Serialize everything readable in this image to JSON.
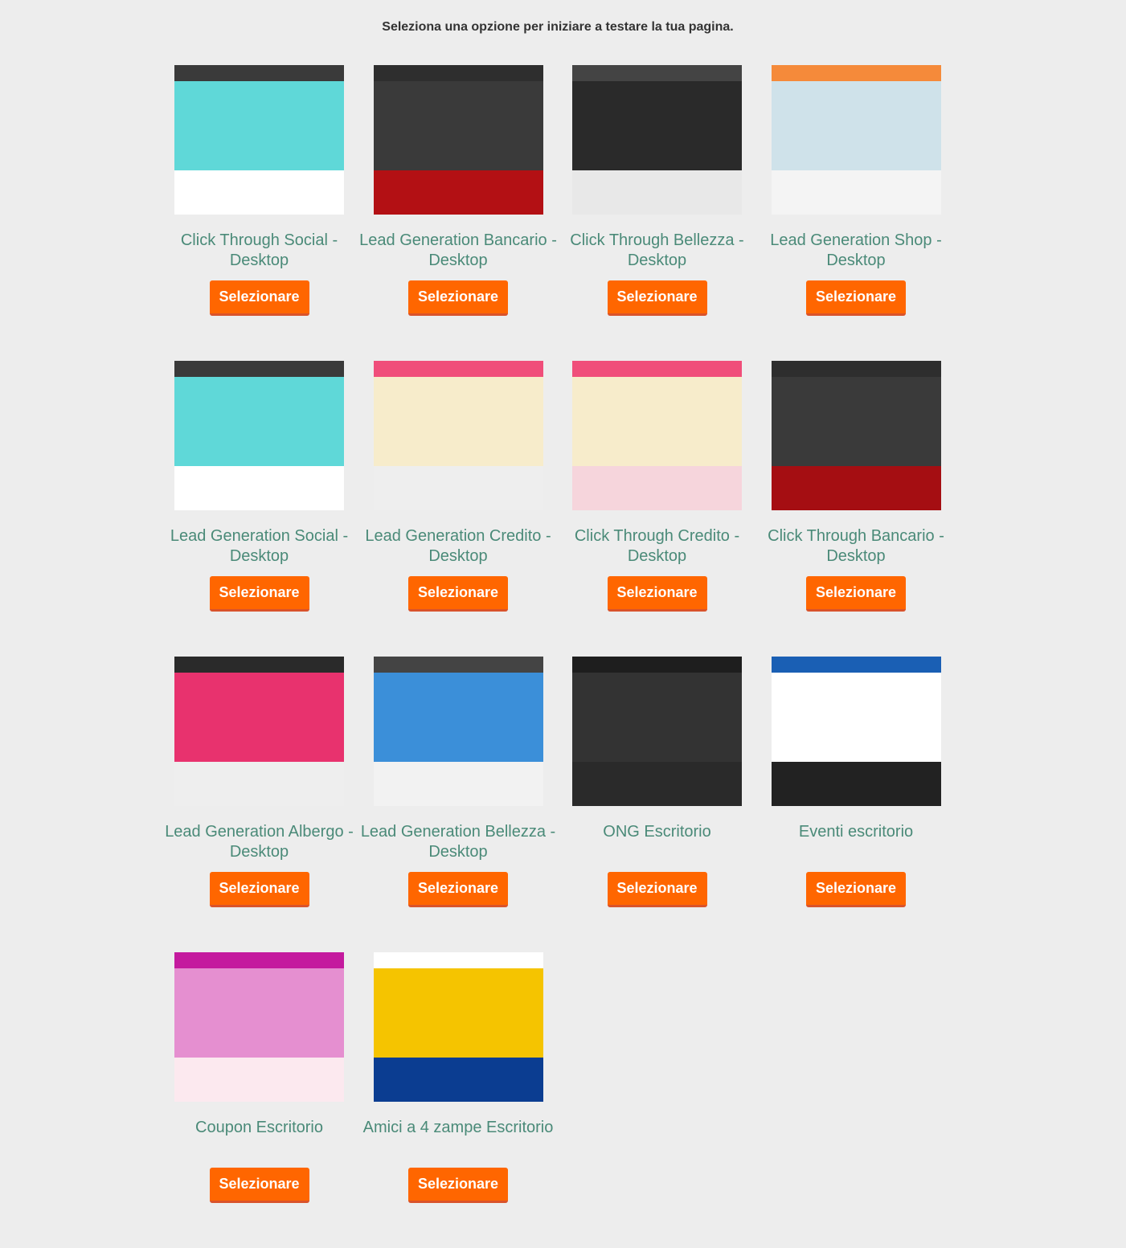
{
  "intro": "Seleziona una opzione per iniziare a testare la tua pagina.",
  "button_label": "Selezionare",
  "accent_color": "#ff6600",
  "templates": [
    {
      "title": "Click Through Social - Desktop",
      "colors": [
        "#3a3a3a",
        "#5fd8d8",
        "#ffffff"
      ]
    },
    {
      "title": "Lead Generation Bancario - Desktop",
      "colors": [
        "#2e2e2e",
        "#3a3a3a",
        "#b31014"
      ]
    },
    {
      "title": "Click Through Bellezza - Desktop",
      "colors": [
        "#444444",
        "#2a2a2a",
        "#e8e8e8"
      ]
    },
    {
      "title": "Lead Generation Shop - Desktop",
      "colors": [
        "#f58a3a",
        "#cfe2ea",
        "#f4f4f4"
      ]
    },
    {
      "title": "Lead Generation Social - Desktop",
      "colors": [
        "#3a3a3a",
        "#5fd8d8",
        "#ffffff"
      ]
    },
    {
      "title": "Lead Generation Credito - Desktop",
      "colors": [
        "#f04e7a",
        "#f7eccb",
        "#eeeeee"
      ]
    },
    {
      "title": "Click Through Credito - Desktop",
      "colors": [
        "#f04e7a",
        "#f7eccb",
        "#f6d5dc"
      ]
    },
    {
      "title": "Click Through Bancario - Desktop",
      "colors": [
        "#2e2e2e",
        "#3a3a3a",
        "#a50e12"
      ]
    },
    {
      "title": "Lead Generation Albergo - Desktop",
      "colors": [
        "#2a2a2a",
        "#e8326e",
        "#eeeeee"
      ]
    },
    {
      "title": "Lead Generation Bellezza - Desktop",
      "colors": [
        "#444444",
        "#3b8fd9",
        "#f2f2f2"
      ]
    },
    {
      "title": "ONG Escritorio",
      "colors": [
        "#1e1e1e",
        "#333333",
        "#2a2a2a"
      ]
    },
    {
      "title": "Eventi escritorio",
      "colors": [
        "#1a5fb4",
        "#ffffff",
        "#222222"
      ]
    },
    {
      "title": "Coupon Escritorio",
      "colors": [
        "#c41a9e",
        "#e58fd0",
        "#fce9ef"
      ]
    },
    {
      "title": "Amici a 4 zampe Escritorio",
      "colors": [
        "#ffffff",
        "#f5c400",
        "#0b3d91"
      ]
    }
  ]
}
